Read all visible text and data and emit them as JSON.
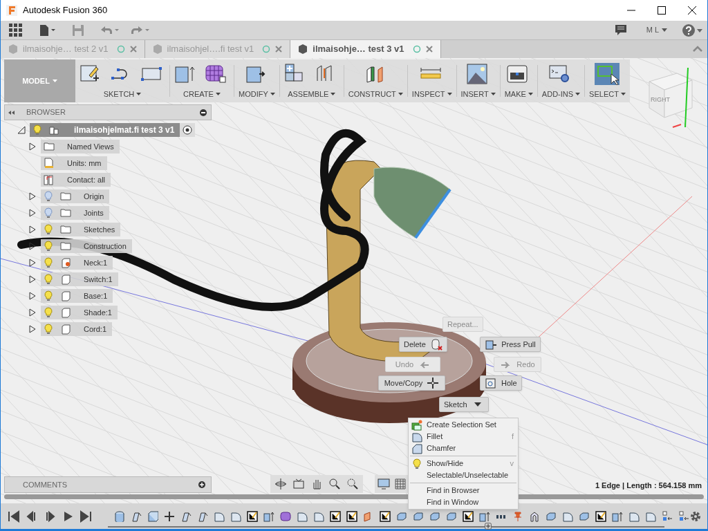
{
  "window": {
    "title": "Autodesk Fusion 360"
  },
  "app_bar": {
    "user": "M L"
  },
  "tabs": [
    {
      "label": "ilmaisohje… test 2 v1",
      "selected": false
    },
    {
      "label": "ilmaisohjel….fi test v1",
      "selected": false
    },
    {
      "label": "ilmaisohje… test 3 v1",
      "selected": true
    }
  ],
  "toolbar": {
    "workspace": "MODEL",
    "groups": [
      {
        "label": "SKETCH",
        "active": false
      },
      {
        "label": "CREATE",
        "active": false
      },
      {
        "label": "MODIFY",
        "active": false
      },
      {
        "label": "ASSEMBLE",
        "active": false
      },
      {
        "label": "CONSTRUCT",
        "active": false
      },
      {
        "label": "INSPECT",
        "active": false
      },
      {
        "label": "INSERT",
        "active": false
      },
      {
        "label": "MAKE",
        "active": false
      },
      {
        "label": "ADD-INS",
        "active": false
      },
      {
        "label": "SELECT",
        "active": true
      }
    ]
  },
  "viewcube": {
    "face": "RIGHT"
  },
  "browser": {
    "title": "BROWSER",
    "root": {
      "label": "ilmaisohjelmat.fi test 3 v1",
      "expanded": true,
      "visible": true
    },
    "items": [
      {
        "kind": "folder",
        "label": "Named Views",
        "expandable": true
      },
      {
        "kind": "units",
        "label": "Units: mm",
        "expandable": false
      },
      {
        "kind": "contact",
        "label": "Contact: all",
        "expandable": false
      },
      {
        "kind": "folder",
        "label": "Origin",
        "expandable": true,
        "visible": false
      },
      {
        "kind": "folder",
        "label": "Joints",
        "expandable": true,
        "visible": false
      },
      {
        "kind": "folder",
        "label": "Sketches",
        "expandable": true,
        "visible": true
      },
      {
        "kind": "folder",
        "label": "Construction",
        "expandable": true,
        "visible": true
      },
      {
        "kind": "pinned",
        "label": "Neck:1",
        "expandable": true,
        "visible": true
      },
      {
        "kind": "component",
        "label": "Switch:1",
        "expandable": true,
        "visible": true
      },
      {
        "kind": "component",
        "label": "Base:1",
        "expandable": true,
        "visible": true
      },
      {
        "kind": "component",
        "label": "Shade:1",
        "expandable": true,
        "visible": true
      },
      {
        "kind": "component",
        "label": "Cord:1",
        "expandable": true,
        "visible": true
      }
    ]
  },
  "marking_menu": [
    {
      "label": "Repeat...",
      "disabled": true
    },
    {
      "label": "Delete",
      "disabled": false
    },
    {
      "label": "Press Pull",
      "disabled": false
    },
    {
      "label": "Undo",
      "disabled": true
    },
    {
      "label": "Redo",
      "disabled": true
    },
    {
      "label": "Move/Copy",
      "disabled": false
    },
    {
      "label": "Hole",
      "disabled": false
    },
    {
      "label": "Sketch",
      "disabled": false
    }
  ],
  "context_menu": [
    {
      "kind": "item",
      "label": "Create Selection Set"
    },
    {
      "kind": "item",
      "label": "Fillet",
      "shortcut": "f"
    },
    {
      "kind": "item",
      "label": "Chamfer"
    },
    {
      "kind": "separator"
    },
    {
      "kind": "item",
      "label": "Show/Hide",
      "shortcut": "v"
    },
    {
      "kind": "item",
      "label": "Selectable/Unselectable"
    },
    {
      "kind": "separator"
    },
    {
      "kind": "item",
      "label": "Find in Browser"
    },
    {
      "kind": "item",
      "label": "Find in Window"
    }
  ],
  "comments": {
    "title": "COMMENTS"
  },
  "status": "1 Edge | Length : 564.158 mm"
}
